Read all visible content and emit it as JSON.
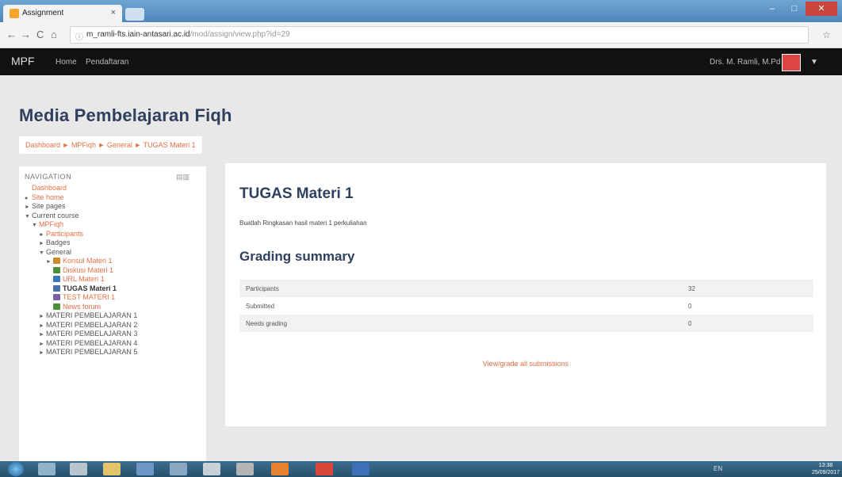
{
  "browser": {
    "tab_title": "Assignment",
    "tab_close": "×",
    "url_host": "m_ramli-fts.iain-antasari.ac.id",
    "url_path": "/mod/assign/view.php?id=29",
    "back": "←",
    "forward": "→",
    "reload": "C",
    "home": "⌂",
    "star": "☆"
  },
  "navbar": {
    "brand": "MPF",
    "menu": [
      "Home",
      "Pendaftaran"
    ],
    "user": "Drs. M. Ramli, M.Pd"
  },
  "page": {
    "title": "Media Pembelajaran Fiqh",
    "breadcrumb": "Dashboard ► MPFiqh ► General ► TUGAS Materi 1"
  },
  "navigation": {
    "header": "NAVIGATION",
    "items": [
      {
        "label": "Dashboard",
        "indent": 0,
        "arrow": "",
        "link": true
      },
      {
        "label": "Site home",
        "indent": 0,
        "arrow": "●",
        "link": true
      },
      {
        "label": "Site pages",
        "indent": 0,
        "arrow": "►",
        "link": false
      },
      {
        "label": "Current course",
        "indent": 0,
        "arrow": "▼",
        "link": false
      },
      {
        "label": "MPFiqh",
        "indent": 1,
        "arrow": "▼",
        "link": true
      },
      {
        "label": "Participants",
        "indent": 2,
        "arrow": "►",
        "link": true
      },
      {
        "label": "Badges",
        "indent": 2,
        "arrow": "►",
        "link": false
      },
      {
        "label": "General",
        "indent": 2,
        "arrow": "▼",
        "link": false
      },
      {
        "label": "Konsul Materi 1",
        "indent": 3,
        "arrow": "►",
        "link": true,
        "icon": "#d08a2e"
      },
      {
        "label": "Diskusi Materi 1",
        "indent": 3,
        "arrow": "",
        "link": true,
        "icon": "#4c8f3a"
      },
      {
        "label": "URL Materi 1",
        "indent": 3,
        "arrow": "",
        "link": true,
        "icon": "#3a77b8"
      },
      {
        "label": "TUGAS Materi 1",
        "indent": 3,
        "arrow": "",
        "link": false,
        "bold": true,
        "icon": "#4a6fa5"
      },
      {
        "label": "TEST MATERI 1",
        "indent": 3,
        "arrow": "",
        "link": true,
        "icon": "#7a5fa5"
      },
      {
        "label": "News forum",
        "indent": 3,
        "arrow": "",
        "link": true,
        "icon": "#4c8f3a"
      },
      {
        "label": "MATERI PEMBELAJARAN 1",
        "indent": 2,
        "arrow": "►",
        "link": false
      },
      {
        "label": "MATERI PEMBELAJARAN 2",
        "indent": 2,
        "arrow": "►",
        "link": false
      },
      {
        "label": "MATERI PEMBELAJARAN 3",
        "indent": 2,
        "arrow": "►",
        "link": false
      },
      {
        "label": "MATERI PEMBELAJARAN 4",
        "indent": 2,
        "arrow": "►",
        "link": false
      },
      {
        "label": "MATERI PEMBELAJARAN 5",
        "indent": 2,
        "arrow": "►",
        "link": false
      }
    ]
  },
  "assignment": {
    "title": "TUGAS Materi 1",
    "intro": "Buatlah Ringkasan hasil materi 1 perkuliahan",
    "grading_title": "Grading summary",
    "rows": [
      {
        "label": "Participants",
        "value": "32"
      },
      {
        "label": "Submitted",
        "value": "0"
      },
      {
        "label": "Needs grading",
        "value": "0"
      }
    ],
    "view_link": "View/grade all submissions"
  },
  "taskbar": {
    "tray": "EN",
    "time": "13:38",
    "date": "25/09/2017"
  },
  "colors": {
    "link": "#e56f45",
    "heading": "#2f3f5e",
    "navbar": "#111111"
  }
}
